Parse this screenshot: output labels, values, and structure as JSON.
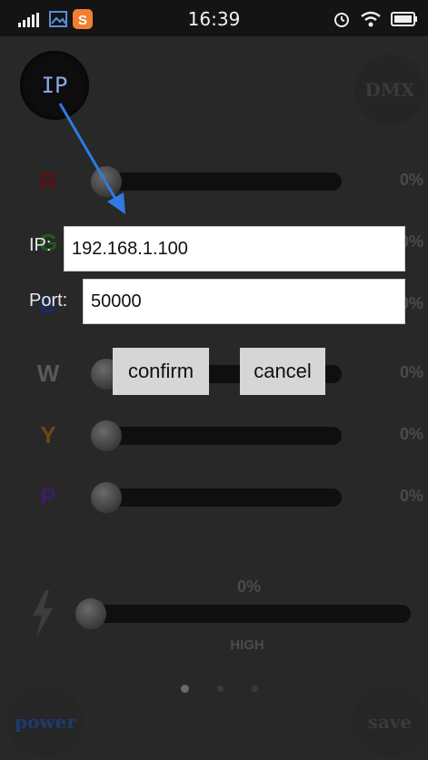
{
  "status_bar": {
    "time": "16:39",
    "icons_left": [
      "signal-icon",
      "gallery-icon",
      "app-s-icon"
    ],
    "icons_right": [
      "alarm-icon",
      "wifi-icon",
      "battery-icon"
    ]
  },
  "top_buttons": {
    "ip": "IP",
    "dmx": "DMX"
  },
  "bottom_buttons": {
    "power": "power",
    "save": "save"
  },
  "channels": [
    {
      "letter": "R",
      "color": "#5a1010",
      "percent": "0%",
      "value": 0
    },
    {
      "letter": "G",
      "color": "#1f5a1f",
      "percent": "0%",
      "value": 0
    },
    {
      "letter": "B",
      "color": "#1b2b6e",
      "percent": "0%",
      "value": 0
    },
    {
      "letter": "W",
      "color": "#5a5a5a",
      "percent": "0%",
      "value": 0
    },
    {
      "letter": "Y",
      "color": "#6a4a10",
      "percent": "0%",
      "value": 0
    },
    {
      "letter": "P",
      "color": "#3c1e6a",
      "percent": "0%",
      "value": 0
    }
  ],
  "master": {
    "percent": "0%",
    "label": "HIGH",
    "value": 0
  },
  "dialog": {
    "ip_label": "IP:",
    "ip_value": "192.168.1.100",
    "port_label": "Port:",
    "port_value": "50000",
    "confirm": "confirm",
    "cancel": "cancel"
  },
  "pager": {
    "count": 3,
    "active": 0
  },
  "annotation_arrow_color": "#2f7ae5"
}
